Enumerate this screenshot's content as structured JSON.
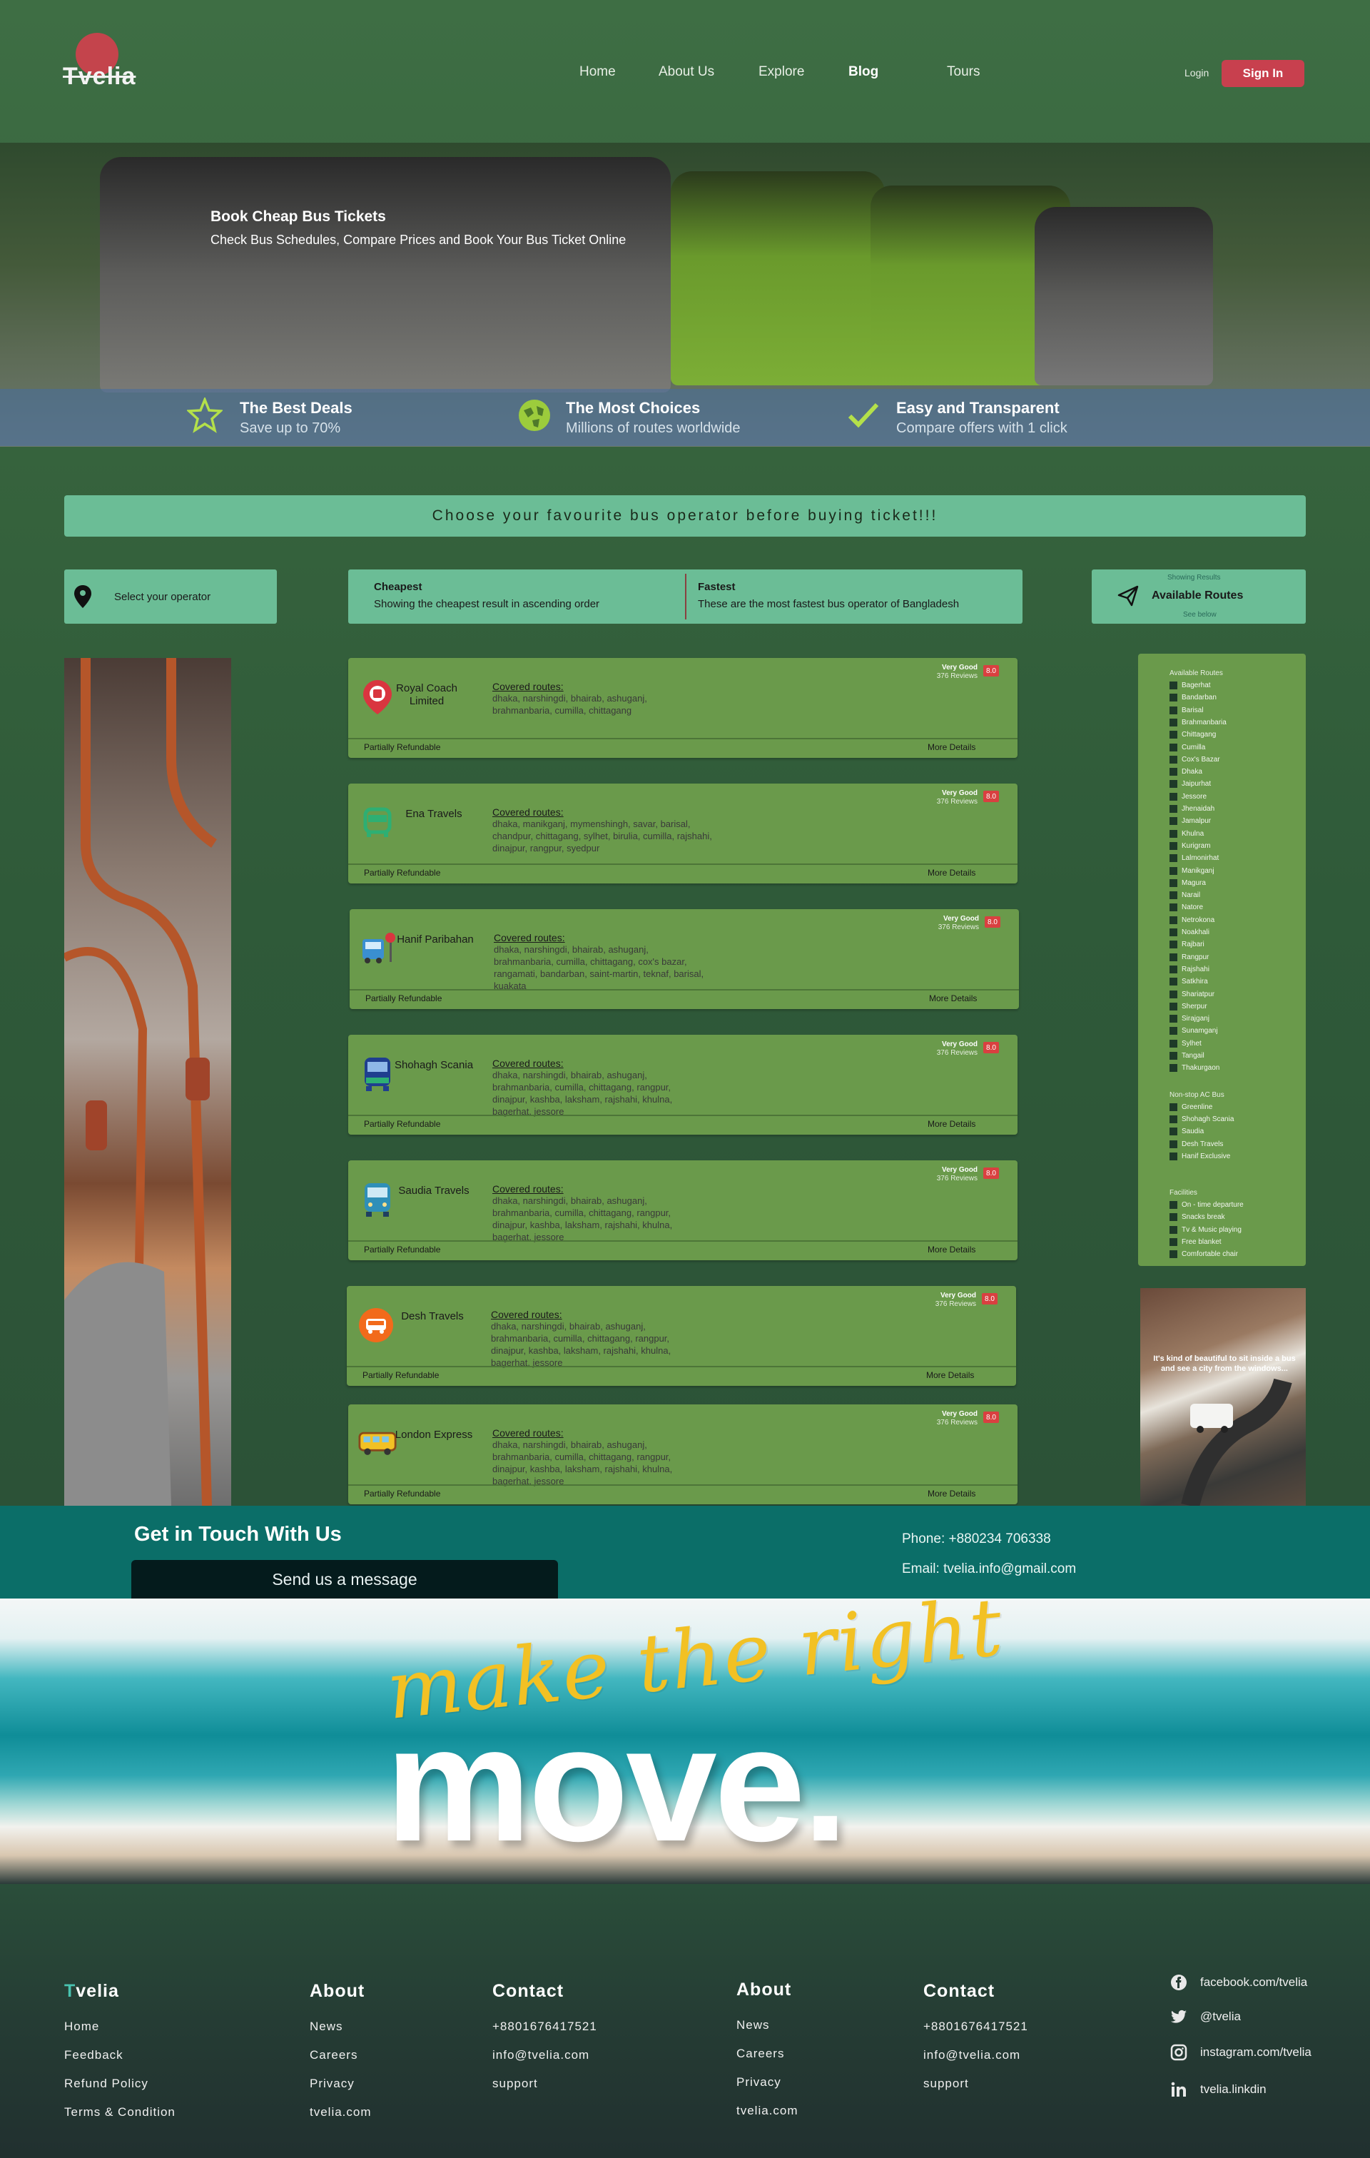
{
  "brand": {
    "logo_text": "Tvelia"
  },
  "nav": {
    "items": [
      "Home",
      "About Us",
      "Explore",
      "Blog",
      "Tours"
    ],
    "login": "Login",
    "signin": "Sign In"
  },
  "hero": {
    "title": "Book Cheap Bus Tickets",
    "subtitle": "Check Bus Schedules, Compare Prices and Book Your Bus Ticket Online",
    "features": [
      {
        "icon": "star-icon",
        "title": "The Best Deals",
        "sub": "Save up to 70%"
      },
      {
        "icon": "globe-icon",
        "title": "The Most Choices",
        "sub": "Millions of routes worldwide"
      },
      {
        "icon": "check-icon",
        "title": "Easy and Transparent",
        "sub": "Compare offers with 1 click"
      }
    ]
  },
  "banner": "Choose your favourite bus operator before buying ticket!!!",
  "select_operator": "Select your operator",
  "tabs": [
    {
      "title": "Cheapest",
      "desc": "Showing the cheapest result in ascending order"
    },
    {
      "title": "Fastest",
      "desc": "These are the most fastest bus operator of Bangladesh"
    }
  ],
  "available": {
    "small": "Showing Results",
    "title": "Available Routes",
    "see": "See below"
  },
  "cards": [
    {
      "name": "Royal Coach Limited",
      "icon": "map-pin-bus-icon",
      "covered": "Covered routes:",
      "routes": "dhaka, narshingdi, bhairab, ashuganj, brahmanbaria, cumilla, chittagang",
      "rating": "Very Good",
      "reviews": "376 Reviews",
      "score": "8.0",
      "refund": "Partially Refundable",
      "more": "More Details"
    },
    {
      "name": "Ena Travels",
      "icon": "bus-front-icon",
      "covered": "Covered routes:",
      "routes": "dhaka, manikganj, mymenshingh, savar, barisal, chandpur, chittagang, sylhet, birulia, cumilla, rajshahi, dinajpur, rangpur, syedpur",
      "rating": "Very Good",
      "reviews": "376 Reviews",
      "score": "8.0",
      "refund": "Partially Refundable",
      "more": "More Details"
    },
    {
      "name": "Hanif Paribahan",
      "icon": "bus-stop-icon",
      "covered": "Covered routes:",
      "routes": "dhaka, narshingdi, bhairab, ashuganj, brahmanbaria, cumilla, chittagang, cox's bazar, rangamati, bandarban, saint-martin, teknaf, barisal, kuakata",
      "rating": "Very Good",
      "reviews": "376 Reviews",
      "score": "8.0",
      "refund": "Partially Refundable",
      "more": "More Details"
    },
    {
      "name": "Shohagh Scania",
      "icon": "bus-blue-icon",
      "covered": "Covered routes:",
      "routes": "dhaka, narshingdi, bhairab, ashuganj, brahmanbaria, cumilla, chittagang, rangpur, dinajpur, kashba, laksham, rajshahi, khulna, bagerhat, jessore",
      "rating": "Very Good",
      "reviews": "376 Reviews",
      "score": "8.0",
      "refund": "Partially Refundable",
      "more": "More Details"
    },
    {
      "name": "Saudia Travels",
      "icon": "bus-teal-icon",
      "covered": "Covered routes:",
      "routes": "dhaka, narshingdi, bhairab, ashuganj, brahmanbaria, cumilla, chittagang, rangpur, dinajpur, kashba, laksham, rajshahi, khulna, bagerhat, jessore",
      "rating": "Very Good",
      "reviews": "376 Reviews",
      "score": "8.0",
      "refund": "Partially Refundable",
      "more": "More Details"
    },
    {
      "name": "Desh Travels",
      "icon": "bus-orange-icon",
      "covered": "Covered routes:",
      "routes": "dhaka, narshingdi, bhairab, ashuganj, brahmanbaria, cumilla, chittagang, rangpur, dinajpur, kashba, laksham, rajshahi, khulna, bagerhat, jessore",
      "rating": "Very Good",
      "reviews": "376 Reviews",
      "score": "8.0",
      "refund": "Partially Refundable",
      "more": "More Details"
    },
    {
      "name": "London Express",
      "icon": "bus-side-icon",
      "covered": "Covered routes:",
      "routes": "dhaka, narshingdi, bhairab, ashuganj, brahmanbaria, cumilla, chittagang, rangpur, dinajpur, kashba, laksham, rajshahi, khulna, bagerhat, jessore",
      "rating": "Very Good",
      "reviews": "376 Reviews",
      "score": "8.0",
      "refund": "Partially Refundable",
      "more": "More Details"
    }
  ],
  "filters": {
    "routes_title": "Available Routes",
    "routes": [
      "Bagerhat",
      "Bandarban",
      "Barisal",
      "Brahmanbaria",
      "Chittagang",
      "Cumilla",
      "Cox's Bazar",
      "Dhaka",
      "Jaipurhat",
      "Jessore",
      "Jhenaidah",
      "Jamalpur",
      "Khulna",
      "Kurigram",
      "Lalmonirhat",
      "Manikganj",
      "Magura",
      "Narail",
      "Natore",
      "Netrokona",
      "Noakhali",
      "Rajbari",
      "Rangpur",
      "Rajshahi",
      "Satkhira",
      "Shariatpur",
      "Sherpur",
      "Sirajganj",
      "Sunamganj",
      "Sylhet",
      "Tangail",
      "Thakurgaon"
    ],
    "ac_title": "Non-stop AC Bus",
    "ac": [
      "Greenline",
      "Shohagh Scania",
      "Saudia",
      "Desh Travels",
      "Hanif Exclusive"
    ],
    "fac_title": "Facilities",
    "facilities": [
      "On - time departure",
      "Snacks break",
      "Tv & Music playing",
      "Free blanket",
      "Comfortable chair"
    ]
  },
  "right_image_caption": "It's kind of beautiful to sit inside a bus and see a city from the windows...",
  "contact": {
    "title": "Get in Touch With Us",
    "send": "Send us a message",
    "phone": "Phone:  +880234 706338",
    "email": "Email:  tvelia.info@gmail.com"
  },
  "promo": {
    "script": "make the right",
    "big": "move."
  },
  "footer": {
    "brand": "Tvelia",
    "col1": [
      "Home",
      "Feedback",
      "Refund Policy",
      "Terms & Condition"
    ],
    "about1_title": "About",
    "about1": [
      "News",
      "Careers",
      "Privacy",
      "tvelia.com"
    ],
    "contact1_title": "Contact",
    "contact1": [
      "+8801676417521",
      "info@tvelia.com",
      "support"
    ],
    "about2_title": "About",
    "about2": [
      "News",
      "Careers",
      "Privacy",
      "tvelia.com"
    ],
    "contact2_title": "Contact",
    "contact2": [
      "+8801676417521",
      "info@tvelia.com",
      "support"
    ],
    "social": [
      {
        "icon": "facebook-icon",
        "text": "facebook.com/tvelia"
      },
      {
        "icon": "twitter-icon",
        "text": "@tvelia"
      },
      {
        "icon": "instagram-icon",
        "text": "instagram.com/tvelia"
      },
      {
        "icon": "linkedin-icon",
        "text": "tvelia.linkdin"
      }
    ]
  },
  "colors": {
    "bg": "#3a6a42",
    "accent": "#6bbd96",
    "card": "#6a9a4b",
    "signin": "#c8404e",
    "contact": "#0b6e68",
    "promo_yellow": "#f2c124"
  }
}
